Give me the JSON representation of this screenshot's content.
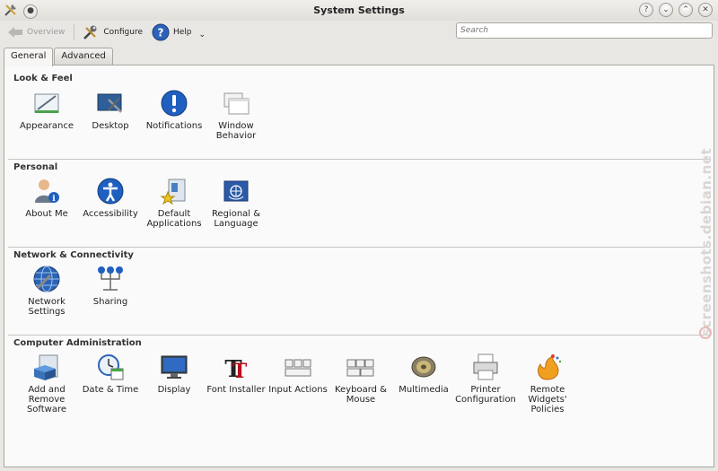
{
  "window": {
    "title": "System Settings",
    "buttons": [
      "?",
      "⌄",
      "⌃",
      "✕"
    ]
  },
  "toolbar": {
    "overview": "Overview",
    "configure": "Configure",
    "help": "Help",
    "search_placeholder": "Search"
  },
  "tabs": [
    "General",
    "Advanced"
  ],
  "sections": [
    {
      "title": "Look & Feel",
      "items": [
        "Appearance",
        "Desktop",
        "Notifications",
        "Window\nBehavior"
      ]
    },
    {
      "title": "Personal",
      "items": [
        "About Me",
        "Accessibility",
        "Default\nApplications",
        "Regional &\nLanguage"
      ]
    },
    {
      "title": "Network & Connectivity",
      "items": [
        "Network\nSettings",
        "Sharing"
      ]
    },
    {
      "title": "Computer Administration",
      "items": [
        "Add and\nRemove\nSoftware",
        "Date & Time",
        "Display",
        "Font Installer",
        "Input Actions",
        "Keyboard &\nMouse",
        "Multimedia",
        "Printer\nConfiguration",
        "Remote\nWidgets'\nPolicies"
      ]
    }
  ],
  "watermark": "screenshots.debian.net"
}
